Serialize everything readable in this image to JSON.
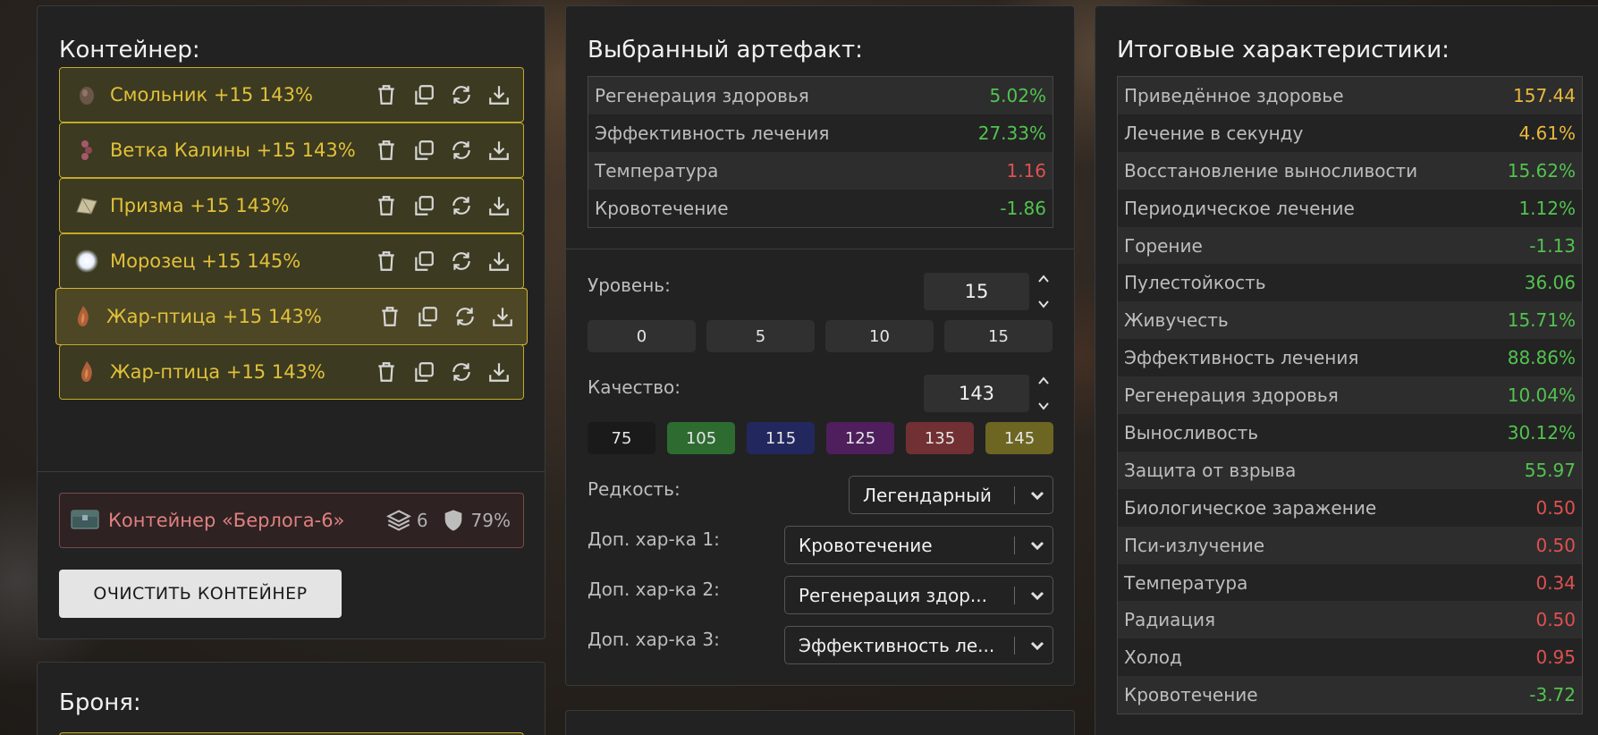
{
  "container": {
    "title": "Контейнер:",
    "artifacts": [
      {
        "name": "Смольник +15 143%",
        "icon": "resin-artifact-icon"
      },
      {
        "name": "Ветка Калины +15 143%",
        "icon": "kalina-branch-icon"
      },
      {
        "name": "Призма +15 143%",
        "icon": "prism-icon"
      },
      {
        "name": "Морозец +15 145%",
        "icon": "frost-orb-icon"
      },
      {
        "name": "Жар-птица +15 143%",
        "icon": "firebird-icon"
      },
      {
        "name": "Жар-птица +15 143%",
        "icon": "firebird-icon"
      }
    ],
    "info": {
      "name": "Контейнер «Берлога-6»",
      "slots": "6",
      "protection": "79%"
    },
    "clear_label": "ОЧИСТИТЬ КОНТЕЙНЕР"
  },
  "armor": {
    "title": "Броня:"
  },
  "selected": {
    "title": "Выбранный артефакт:",
    "stats": [
      {
        "label": "Регенерация здоровья",
        "value": "5.02%",
        "tone": "pos"
      },
      {
        "label": "Эффективность лечения",
        "value": "27.33%",
        "tone": "pos"
      },
      {
        "label": "Температура",
        "value": "1.16",
        "tone": "neg"
      },
      {
        "label": "Кровотечение",
        "value": "-1.86",
        "tone": "pos"
      }
    ],
    "level": {
      "label": "Уровень:",
      "value": "15",
      "presets": [
        "0",
        "5",
        "10",
        "15"
      ]
    },
    "quality": {
      "label": "Качество:",
      "value": "143",
      "presets": [
        {
          "v": "75",
          "color": "#1a1a1a"
        },
        {
          "v": "105",
          "color": "#2e6b30"
        },
        {
          "v": "115",
          "color": "#22285e"
        },
        {
          "v": "125",
          "color": "#4e1f5c"
        },
        {
          "v": "135",
          "color": "#713033"
        },
        {
          "v": "145",
          "color": "#6d6622"
        }
      ]
    },
    "rarity": {
      "label": "Редкость:",
      "value": "Легендарный"
    },
    "extra1": {
      "label": "Доп. хар-ка 1:",
      "value": "Кровотечение"
    },
    "extra2": {
      "label": "Доп. хар-ка 2:",
      "value": "Регенерация здор..."
    },
    "extra3": {
      "label": "Доп. хар-ка 3:",
      "value": "Эффективность ле..."
    }
  },
  "totals": {
    "title": "Итоговые характеристики:",
    "stats": [
      {
        "label": "Приведённое здоровье",
        "value": "157.44",
        "tone": "gold"
      },
      {
        "label": "Лечение в секунду",
        "value": "4.61%",
        "tone": "gold"
      },
      {
        "label": "Восстановление выносливости",
        "value": "15.62%",
        "tone": "pos"
      },
      {
        "label": "Периодическое лечение",
        "value": "1.12%",
        "tone": "pos"
      },
      {
        "label": "Горение",
        "value": "-1.13",
        "tone": "pos"
      },
      {
        "label": "Пулестойкость",
        "value": "36.06",
        "tone": "pos"
      },
      {
        "label": "Живучесть",
        "value": "15.71%",
        "tone": "pos"
      },
      {
        "label": "Эффективность лечения",
        "value": "88.86%",
        "tone": "pos"
      },
      {
        "label": "Регенерация здоровья",
        "value": "10.04%",
        "tone": "pos"
      },
      {
        "label": "Выносливость",
        "value": "30.12%",
        "tone": "pos"
      },
      {
        "label": "Защита от взрыва",
        "value": "55.97",
        "tone": "pos"
      },
      {
        "label": "Биологическое заражение",
        "value": "0.50",
        "tone": "neg"
      },
      {
        "label": "Пси-излучение",
        "value": "0.50",
        "tone": "neg"
      },
      {
        "label": "Температура",
        "value": "0.34",
        "tone": "neg"
      },
      {
        "label": "Радиация",
        "value": "0.50",
        "tone": "neg"
      },
      {
        "label": "Холод",
        "value": "0.95",
        "tone": "neg"
      },
      {
        "label": "Кровотечение",
        "value": "-3.72",
        "tone": "pos"
      }
    ]
  }
}
